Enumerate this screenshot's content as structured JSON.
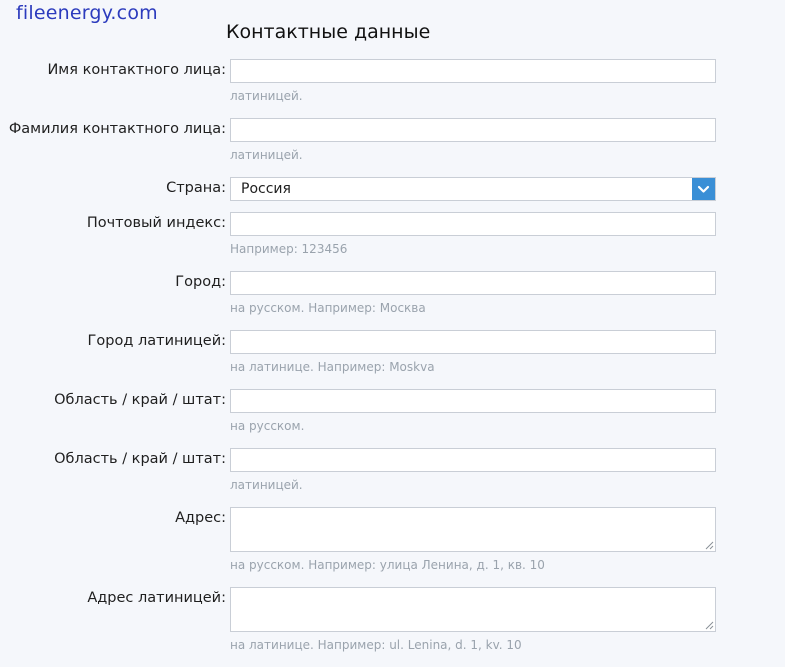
{
  "site": {
    "logo": "fileenergy.com"
  },
  "form": {
    "title": "Контактные данные",
    "first_name": {
      "label": "Имя контактного лица:",
      "value": "",
      "hint": "латиницей."
    },
    "last_name": {
      "label": "Фамилия контактного лица:",
      "value": "",
      "hint": "латиницей."
    },
    "country": {
      "label": "Страна:",
      "selected": "Россия",
      "icon": "chevron-down-icon"
    },
    "postal_code": {
      "label": "Почтовый индекс:",
      "value": "",
      "hint": "Например: 123456"
    },
    "city": {
      "label": "Город:",
      "value": "",
      "hint": "на русском. Например: Москва"
    },
    "city_latin": {
      "label": "Город латиницей:",
      "value": "",
      "hint": "на латинице. Например: Moskva"
    },
    "region": {
      "label": "Область / край / штат:",
      "value": "",
      "hint": "на русском."
    },
    "region_latin": {
      "label": "Область / край / штат:",
      "value": "",
      "hint": "латиницей."
    },
    "address": {
      "label": "Адрес:",
      "value": "",
      "hint": "на русском. Например: улица Ленина, д. 1, кв. 10"
    },
    "address_latin": {
      "label": "Адрес латиницей:",
      "value": "",
      "hint": "на латинице. Например: ul. Lenina, d. 1, kv. 10"
    }
  },
  "colors": {
    "logo": "#2c3bbd",
    "select_button": "#3a8fd6",
    "hint": "#9aa3ad",
    "background": "#f5f7fb"
  }
}
